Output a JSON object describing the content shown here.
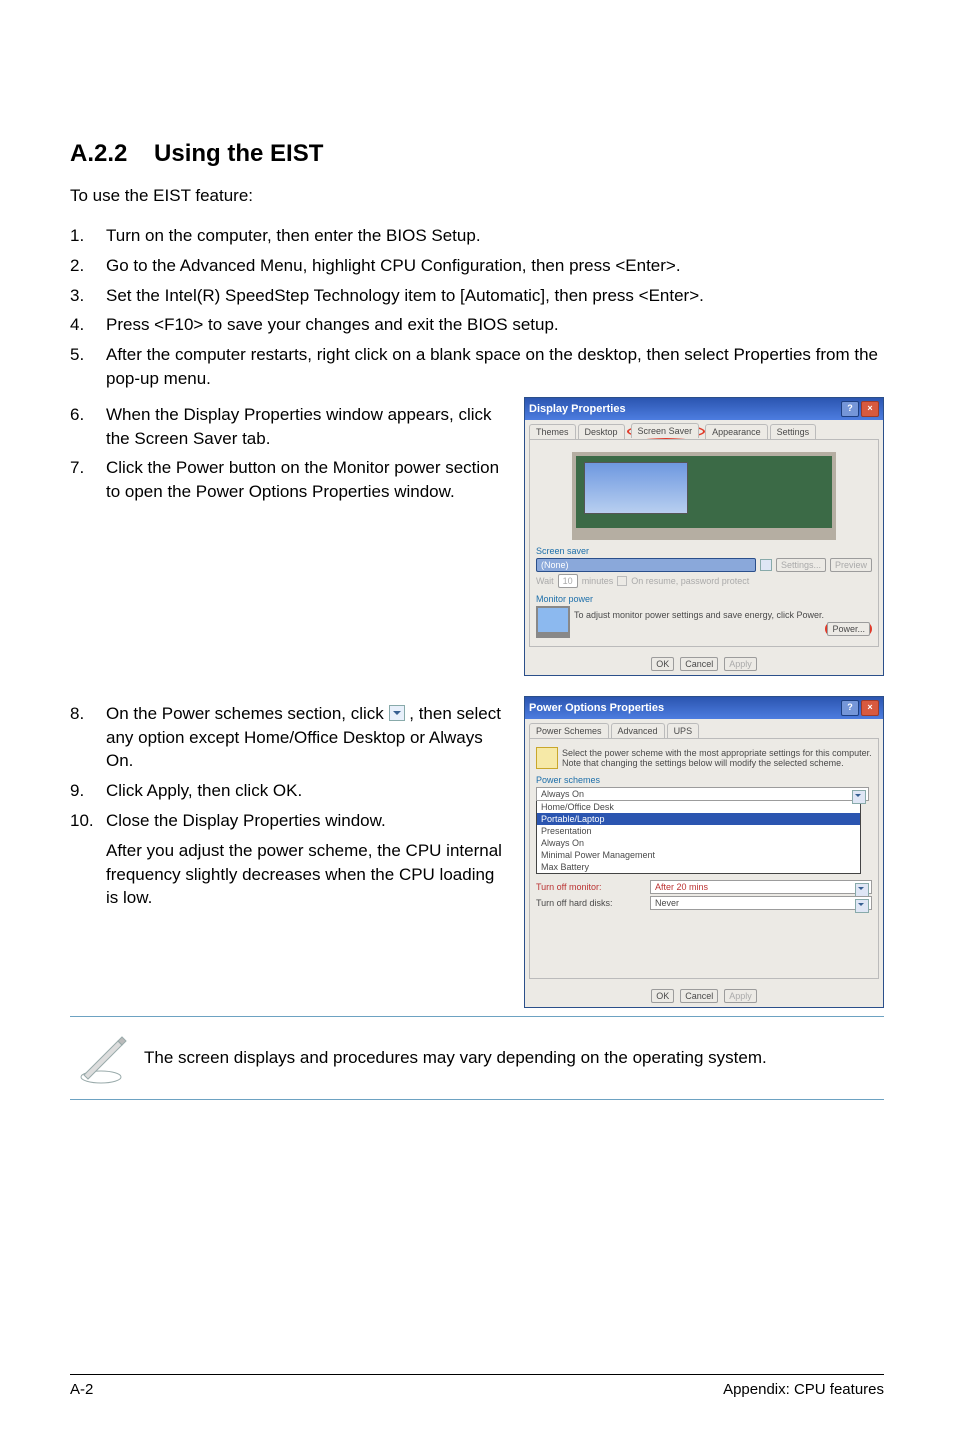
{
  "section": {
    "number": "A.2.2",
    "title": "Using the EIST"
  },
  "intro": "To use the EIST feature:",
  "steps": [
    "Turn on the computer, then enter the BIOS Setup.",
    "Go to the Advanced Menu, highlight CPU Configuration, then press <Enter>.",
    "Set the Intel(R) SpeedStep Technology item to [Automatic], then press <Enter>.",
    "Press <F10> to save your changes and exit the BIOS setup.",
    "After the computer restarts, right click on a blank space on the desktop, then select Properties from the pop-up menu.",
    "When the Display Properties window appears, click the Screen Saver tab.",
    "Click the Power button on the Monitor power section to open the Power Options Properties window.",
    [
      "On the Power schemes section, click ",
      ", then select any option except Home/Office Desktop or Always On."
    ],
    "Click Apply, then click OK.",
    "Close the Display Properties window."
  ],
  "after_note": "After you adjust the power scheme, the CPU internal frequency slightly decreases when the CPU loading is low.",
  "footer_note": "The screen displays and procedures may vary depending on the operating system.",
  "footer": {
    "left": "A-2",
    "right": "Appendix: CPU features"
  },
  "display_properties": {
    "title": "Display Properties",
    "tabs": [
      "Themes",
      "Desktop",
      "Screen Saver",
      "Appearance",
      "Settings"
    ],
    "screensaver_group": "Screen saver",
    "screensaver_value": "(None)",
    "screensaver_buttons": [
      "Settings...",
      "Preview"
    ],
    "wait_label": "Wait",
    "wait_value": "10",
    "wait_unit": "minutes",
    "resume_label": "On resume, password protect",
    "monitor_group": "Monitor power",
    "monitor_text": "To adjust monitor power settings and save energy, click Power.",
    "power_button": "Power...",
    "buttons": [
      "OK",
      "Cancel",
      "Apply"
    ]
  },
  "power_options": {
    "title": "Power Options Properties",
    "tabs": [
      "Power Schemes",
      "Advanced",
      "UPS"
    ],
    "blurb": "Select the power scheme with the most appropriate settings for this computer. Note that changing the settings below will modify the selected scheme.",
    "schemes_group": "Power schemes",
    "scheme_selected": "Always On",
    "scheme_options": [
      "Home/Office Desk",
      "Portable/Laptop",
      "Presentation",
      "Always On",
      "Minimal Power Management",
      "Max Battery"
    ],
    "monitor_row": {
      "label": "Turn off monitor:",
      "value": "After 20 mins"
    },
    "hdd_row": {
      "label": "Turn off hard disks:",
      "value": "Never"
    },
    "buttons": [
      "OK",
      "Cancel",
      "Apply"
    ]
  }
}
